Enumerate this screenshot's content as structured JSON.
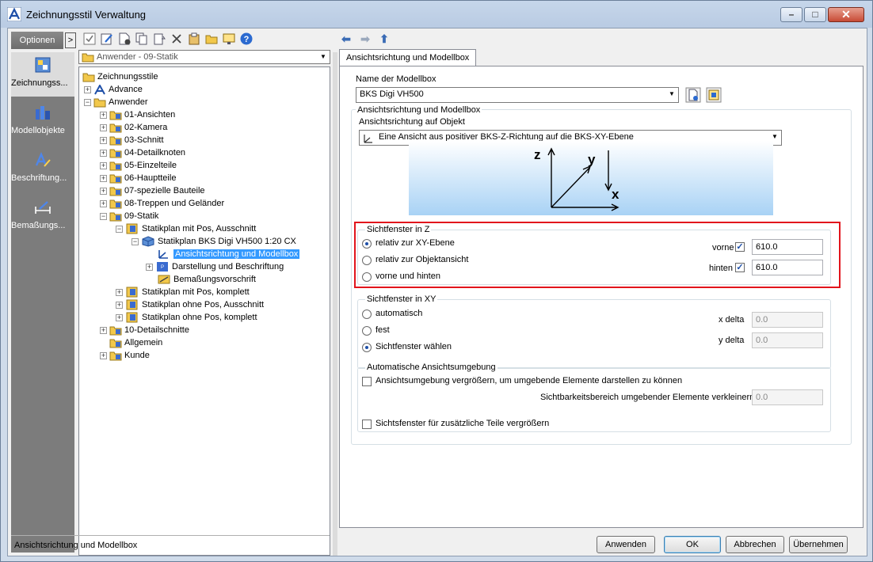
{
  "window": {
    "title": "Zeichnungsstil Verwaltung",
    "min": "–",
    "max": "□",
    "close": "✕"
  },
  "options": {
    "label": "Optionen",
    "arrow": ">"
  },
  "strip": [
    {
      "label": "Zeichnungss...",
      "icon": "drawing-style-icon"
    },
    {
      "label": "Modellobjekte",
      "icon": "model-objects-icon"
    },
    {
      "label": "Beschriftung...",
      "icon": "annotation-icon"
    },
    {
      "label": "Bemaßungs...",
      "icon": "dimension-icon"
    }
  ],
  "tree_combo": {
    "value": "Anwender - 09-Statik"
  },
  "tree": {
    "root": "Zeichnungsstile",
    "advance": "Advance",
    "anwender": "Anwender",
    "items": [
      "01-Ansichten",
      "02-Kamera",
      "03-Schnitt",
      "04-Detailknoten",
      "05-Einzelteile",
      "06-Hauptteile",
      "07-spezielle Bauteile",
      "08-Treppen und Geländer",
      "09-Statik"
    ],
    "statik_children": [
      "Statikplan mit Pos, Ausschnitt",
      "Statikplan BKS Digi VH500 1:20 CX",
      "Ansichtsrichtung und Modellbox",
      "Darstellung und Beschriftung",
      "Bemaßungsvorschrift",
      "Statikplan mit Pos, komplett",
      "Statikplan ohne Pos, Ausschnitt",
      "Statikplan ohne Pos, komplett"
    ],
    "tail": [
      "10-Detailschnitte",
      "Allgemein",
      "Kunde"
    ]
  },
  "tab": {
    "label": "Ansichtsrichtung und Modellbox"
  },
  "form": {
    "modelbox_label": "Name der Modellbox",
    "modelbox_value": "BKS Digi VH500",
    "group_main": "Ansichtsrichtung und Modellbox",
    "direction_label": "Ansichtsrichtung auf Objekt",
    "direction_value": "Eine Ansicht aus positiver BKS-Z-Richtung auf die BKS-XY-Ebene",
    "axis": {
      "z": "z",
      "y": "y",
      "x": "x"
    },
    "z_group": "Sichtfenster in Z",
    "z_opts": [
      "relativ zur XY-Ebene",
      "relativ zur Objektansicht",
      "vorne und hinten"
    ],
    "vorne_label": "vorne",
    "vorne_value": "610.0",
    "hinten_label": "hinten",
    "hinten_value": "610.0",
    "xy_group": "Sichtfenster in XY",
    "xy_opts": [
      "automatisch",
      "fest",
      "Sichtfenster wählen"
    ],
    "xdelta_label": "x delta",
    "xdelta_value": "0.0",
    "ydelta_label": "y delta",
    "ydelta_value": "0.0",
    "env_group": "Automatische Ansichtsumgebung",
    "env_check": "Ansichtsumgebung vergrößern, um umgebende Elemente darstellen zu können",
    "env_reduce_label": "Sichtbarkeitsbereich umgebender Elemente verkleinern",
    "env_reduce_value": "0.0",
    "extra_check": "Sichtsfenster für zusätzliche Teile vergrößern"
  },
  "status": {
    "text": "Ansichtsrichtung und Modellbox"
  },
  "buttons": {
    "apply": "Anwenden",
    "ok": "OK",
    "cancel": "Abbrechen",
    "take": "Übernehmen"
  },
  "colors": {
    "highlight": "#e2141c",
    "selection": "#3399ff"
  }
}
